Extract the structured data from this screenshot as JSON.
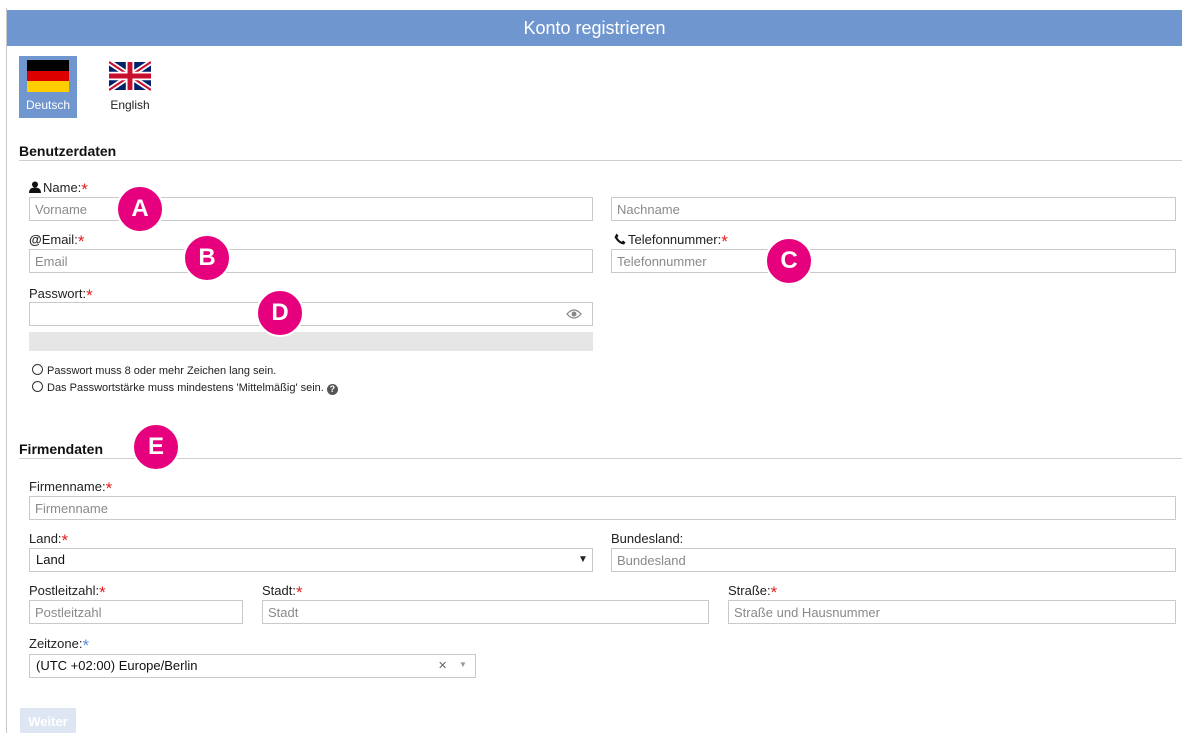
{
  "title": "Konto registrieren",
  "languages": [
    {
      "label": "Deutsch",
      "icon": "german-flag-icon",
      "active": true
    },
    {
      "label": "English",
      "icon": "uk-flag-icon",
      "active": false
    }
  ],
  "user_section": {
    "title": "Benutzerdaten",
    "name_label": "Name:",
    "firstname_placeholder": "Vorname",
    "lastname_placeholder": "Nachname",
    "email_label": "Email:",
    "email_placeholder": "Email",
    "phone_label": "Telefonnummer:",
    "phone_placeholder": "Telefonnummer",
    "password_label": "Passwort:",
    "password_rules": [
      "Passwort muss 8 oder mehr Zeichen lang sein.",
      "Das Passwortstärke muss mindestens 'Mittelmäßig' sein."
    ]
  },
  "company_section": {
    "title": "Firmendaten",
    "company_label": "Firmenname:",
    "company_placeholder": "Firmenname",
    "country_label": "Land:",
    "country_value": "Land",
    "state_label": "Bundesland:",
    "state_placeholder": "Bundesland",
    "zip_label": "Postleitzahl:",
    "zip_placeholder": "Postleitzahl",
    "city_label": "Stadt:",
    "city_placeholder": "Stadt",
    "street_label": "Straße:",
    "street_placeholder": "Straße und Hausnummer",
    "timezone_label": "Zeitzone:",
    "timezone_value": "(UTC +02:00) Europe/Berlin"
  },
  "required_mark": "*",
  "annotations": [
    "A",
    "B",
    "C",
    "D",
    "E"
  ],
  "next_button": "Weiter",
  "colors": {
    "accent": "#7096cf",
    "required": "#e02020",
    "marker": "#e6007e"
  }
}
